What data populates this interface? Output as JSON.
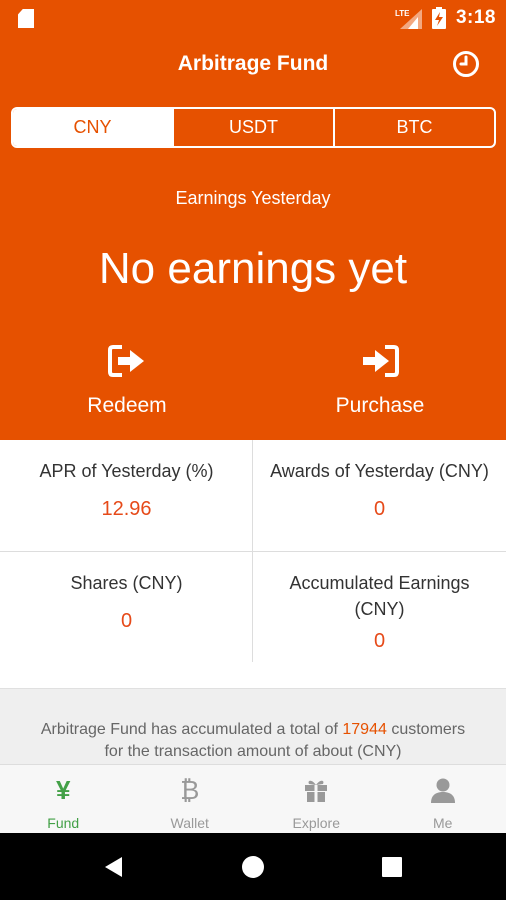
{
  "status_bar": {
    "network": "LTE",
    "time": "3:18"
  },
  "app_bar": {
    "title": "Arbitrage Fund",
    "history_icon": "history-clock-icon"
  },
  "tabs": [
    {
      "label": "CNY"
    },
    {
      "label": "USDT"
    },
    {
      "label": "BTC"
    }
  ],
  "hero": {
    "earnings_label": "Earnings Yesterday",
    "earnings_value": "No earnings yet",
    "redeem_label": "Redeem",
    "purchase_label": "Purchase"
  },
  "stats": {
    "apr_label": "APR of Yesterday (%)",
    "apr_value": "12.96",
    "awards_label": "Awards of Yesterday (CNY)",
    "awards_value": "0",
    "shares_label": "Shares (CNY)",
    "shares_value": "0",
    "accumulated_label": "Accumulated Earnings (CNY)",
    "accumulated_value": "0"
  },
  "summary": {
    "prefix": "Arbitrage Fund has accumulated a total of",
    "customers": "17944",
    "suffix": "customers",
    "line2": "for the transaction amount of about (CNY)"
  },
  "bottom_nav": [
    {
      "label": "Fund",
      "icon": "¥"
    },
    {
      "label": "Wallet",
      "icon": "₿"
    },
    {
      "label": "Explore",
      "icon": "gift-icon"
    },
    {
      "label": "Me",
      "icon": "person-icon"
    }
  ],
  "colors": {
    "primary": "#E65100",
    "value": "#E64A19",
    "nav_active": "#43A047"
  }
}
